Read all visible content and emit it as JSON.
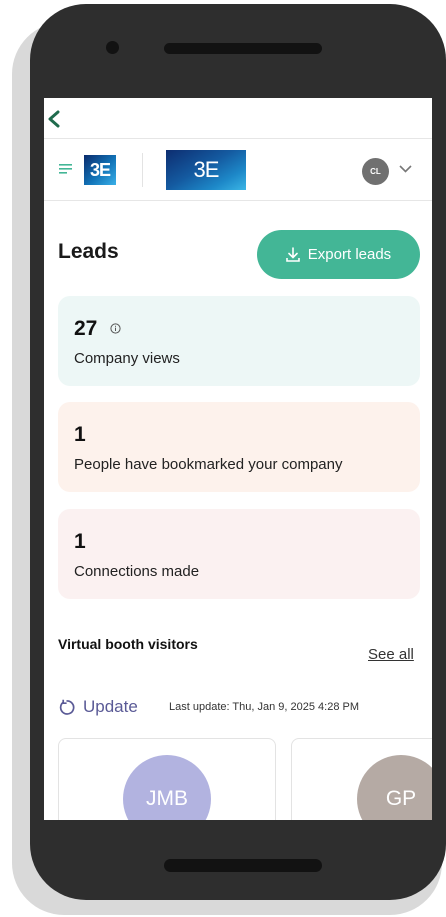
{
  "header": {
    "initials": "CL"
  },
  "leads": {
    "title": "Leads",
    "export_label": "Export leads"
  },
  "stats": [
    {
      "value": "27",
      "label": "Company views"
    },
    {
      "value": "1",
      "label": "People have bookmarked your company"
    },
    {
      "value": "1",
      "label": "Connections made"
    }
  ],
  "visitors": {
    "title": "Virtual booth visitors",
    "see_all": "See all",
    "update_label": "Update",
    "last_update": "Last update: Thu, Jan 9, 2025 4:28 PM",
    "items": [
      {
        "initials": "JMB",
        "color": "#b2b3e0"
      },
      {
        "initials": "GP",
        "color": "#b5aaa4"
      }
    ]
  },
  "colors": {
    "accent": "#43b696",
    "back_arrow": "#1f6b4d"
  },
  "icons": [
    "back-arrow-icon",
    "menu-icon",
    "chevron-down-icon",
    "download-icon",
    "info-icon",
    "refresh-icon"
  ]
}
